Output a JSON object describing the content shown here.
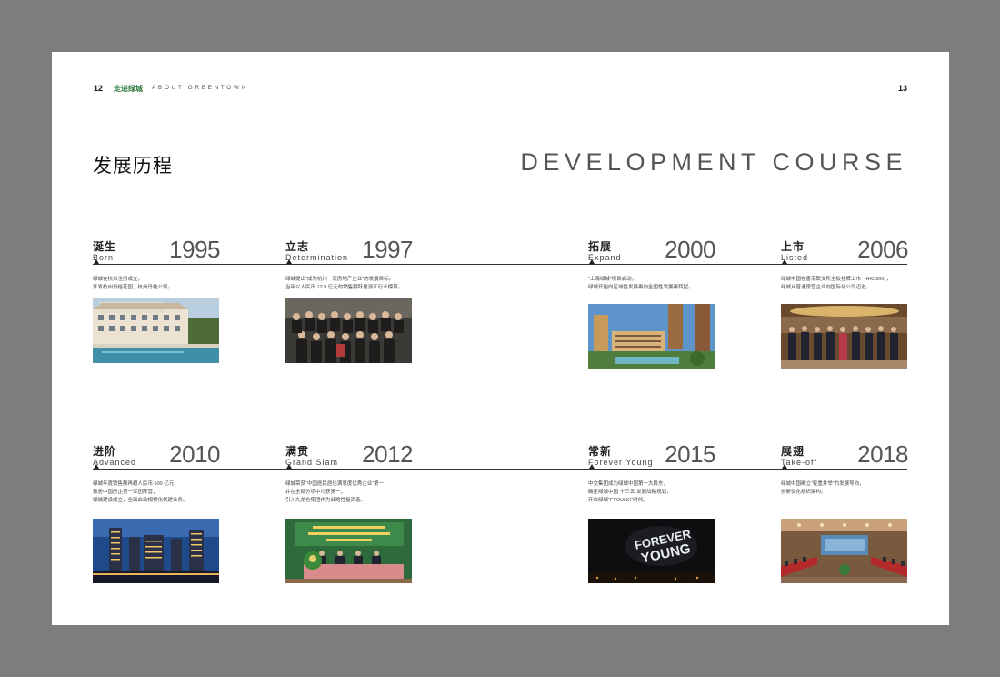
{
  "header": {
    "page_left": "12",
    "section_cn": "走进绿城",
    "section_en": "ABOUT GREENTOWN",
    "page_right": "13"
  },
  "title": {
    "cn": "发展历程",
    "en": "DEVELOPMENT COURSE"
  },
  "timeline": [
    {
      "cn": "诞生",
      "en": "Born",
      "year": "1995",
      "line1": "绿城在杭州注册成立，",
      "line2": "开发杭州丹桂花园、杭州丹桂公寓。",
      "line3": "",
      "photo": "resort-building-with-pool"
    },
    {
      "cn": "立志",
      "en": "Determination",
      "year": "1997",
      "line1": "绿城提出“成为杭州一流房地产企业”的发展目标。",
      "line2": "当年以人民币 12.9 亿元的销售额跃居浙江行业榜首。",
      "line3": "",
      "photo": "team-group-photo"
    },
    {
      "cn": "拓展",
      "en": "Expand",
      "year": "2000",
      "line1": "“上海绿城”项目启动，",
      "line2": "绿城开始向区域性发展再向全国性发展再转型。",
      "line3": "",
      "photo": "residential-towers"
    },
    {
      "cn": "上市",
      "en": "Listed",
      "year": "2006",
      "line1": "绿城中国在香港联交所主板挂牌上市（HK3900），",
      "line2": "绿城从普通房营企业向国际化公司迈进。",
      "line3": "",
      "photo": "listing-ceremony"
    },
    {
      "cn": "进阶",
      "en": "Advanced",
      "year": "2010",
      "line1": "绿城年度销售额再超人民币 600 亿元，",
      "line2": "稳居中国房企第一军团阵营；",
      "line3": "绿城建设成立，全面启动规模化代建业务。",
      "photo": "city-night-skyline"
    },
    {
      "cn": "满贯",
      "en": "Grand Slam",
      "year": "2012",
      "line1": "绿城荣获“中国居民居住满意度优秀企业”第一，",
      "line2": "并在全部分项中均获第一；",
      "line3": "引入九龙仓集团作为战略性投资者。",
      "photo": "press-conference"
    },
    {
      "cn": "常新",
      "en": "Forever Young",
      "year": "2015",
      "line1": "中交集团成为绿城中国第一大股东，",
      "line2": "确定绿城中国“十三五”发展战略规划，",
      "line3": "开启绿城“FYOUNG”时代。",
      "photo": "forever-young-stage",
      "photo_text1": "FOREVER",
      "photo_text2": "YOUNG"
    },
    {
      "cn": "展翅",
      "en": "Take-off",
      "year": "2018",
      "line1": "绿城中国确立“轻重并举”的发展导向，",
      "line2": "创新优化组织架构。",
      "line3": "",
      "photo": "conference-hall"
    }
  ]
}
